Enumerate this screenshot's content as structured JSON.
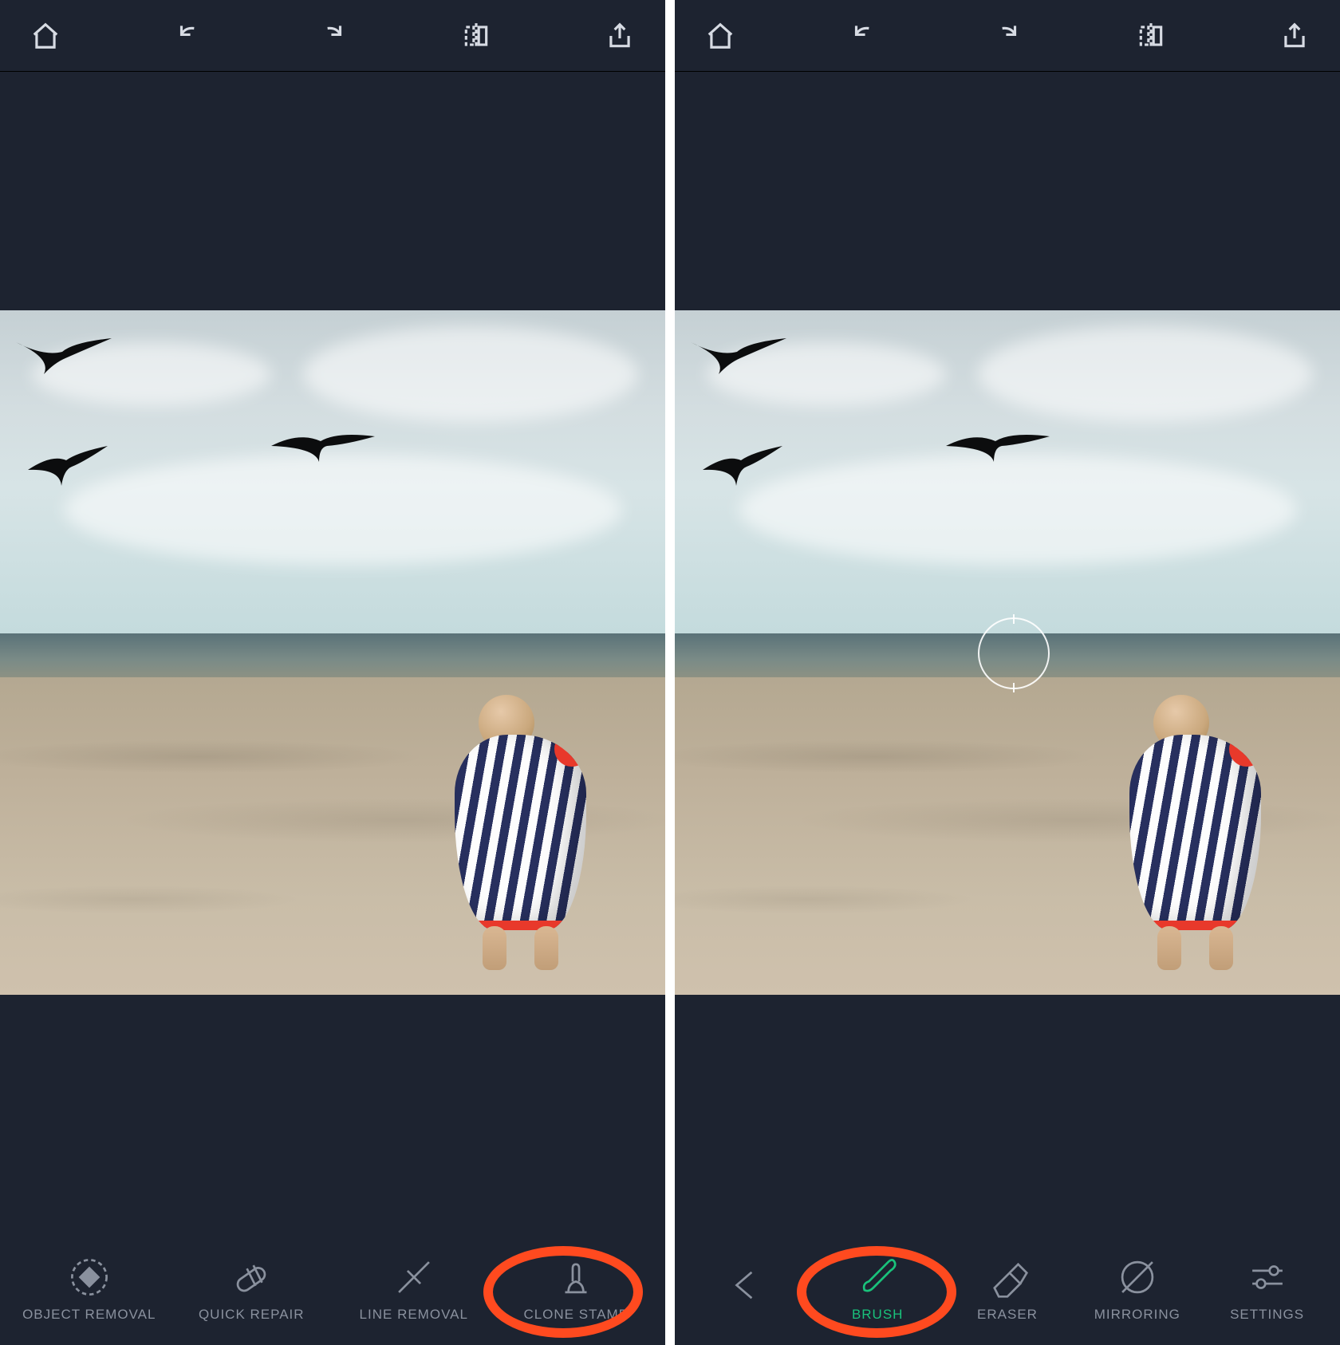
{
  "colors": {
    "bg": "#1d2330",
    "accent": "#19c27b",
    "annotation": "#ff4a1f"
  },
  "topbar_icons": [
    "home",
    "undo",
    "redo",
    "compare",
    "share"
  ],
  "left": {
    "tools": [
      {
        "id": "object-removal",
        "label": "OBJECT REMOVAL",
        "active": false,
        "annotated": false
      },
      {
        "id": "quick-repair",
        "label": "QUICK REPAIR",
        "active": false,
        "annotated": false
      },
      {
        "id": "line-removal",
        "label": "LINE REMOVAL",
        "active": false,
        "annotated": false
      },
      {
        "id": "clone-stamp",
        "label": "CLONE STAMP",
        "active": false,
        "annotated": true
      }
    ]
  },
  "right": {
    "show_crosshair": true,
    "tools": [
      {
        "id": "back",
        "label": "",
        "active": false,
        "annotated": false
      },
      {
        "id": "brush",
        "label": "BRUSH",
        "active": true,
        "annotated": true
      },
      {
        "id": "eraser",
        "label": "ERASER",
        "active": false,
        "annotated": false
      },
      {
        "id": "mirroring",
        "label": "MIRRORING",
        "active": false,
        "annotated": false
      },
      {
        "id": "settings",
        "label": "SETTINGS",
        "active": false,
        "annotated": false
      }
    ]
  }
}
